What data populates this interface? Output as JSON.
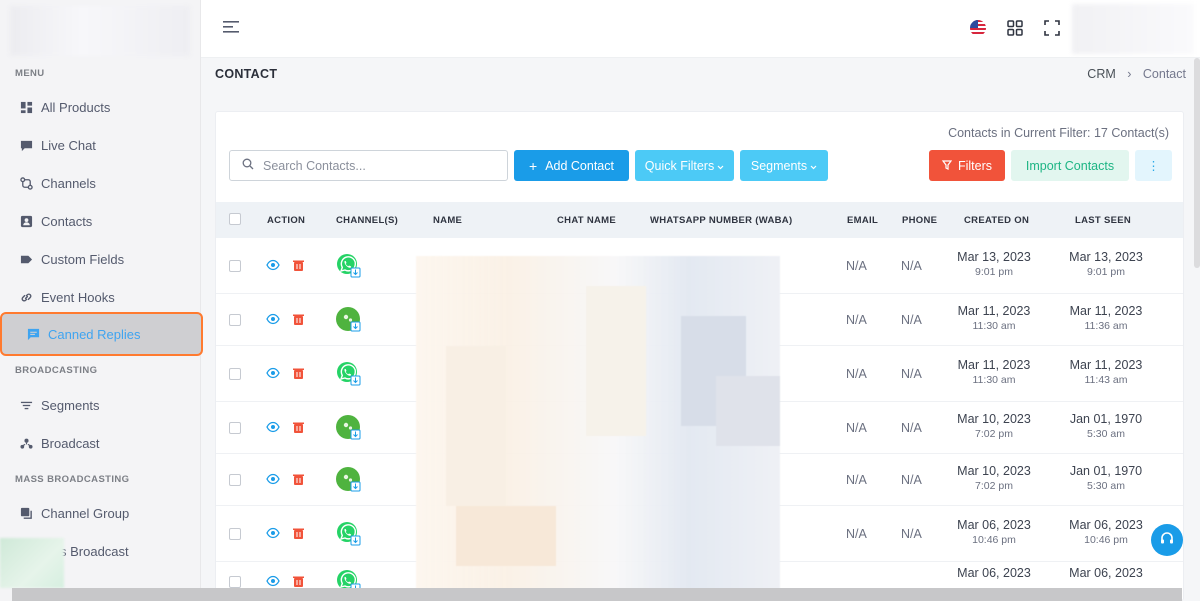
{
  "sidebar": {
    "sections": {
      "menu": "MENU",
      "broadcasting": "BROADCASTING",
      "mass_broadcasting": "MASS BROADCASTING"
    },
    "items": [
      {
        "label": "All Products",
        "icon": "grid-icon"
      },
      {
        "label": "Live Chat",
        "icon": "chat-icon"
      },
      {
        "label": "Channels",
        "icon": "channels-icon"
      },
      {
        "label": "Contacts",
        "icon": "contacts-icon"
      },
      {
        "label": "Custom Fields",
        "icon": "tag-icon"
      },
      {
        "label": "Event Hooks",
        "icon": "link-icon"
      },
      {
        "label": "Canned Replies",
        "icon": "message-icon",
        "active": true
      },
      {
        "label": "Segments",
        "icon": "filter-lines-icon"
      },
      {
        "label": "Broadcast",
        "icon": "broadcast-icon"
      },
      {
        "label": "Channel Group",
        "icon": "layers-icon"
      },
      {
        "label": "s Broadcast",
        "icon": "broadcast-icon"
      }
    ]
  },
  "header": {
    "page_title": "CONTACT",
    "breadcrumb": {
      "parent": "CRM",
      "current": "Contact"
    },
    "separator": "›"
  },
  "toolbar": {
    "filter_count": "Contacts in Current Filter: 17 Contact(s)",
    "search_placeholder": "Search Contacts...",
    "add_contact": "Add Contact",
    "quick_filters": "Quick Filters",
    "segments": "Segments",
    "filters": "Filters",
    "import_contacts": "Import Contacts",
    "more": "⋮"
  },
  "table": {
    "headers": {
      "action": "ACTION",
      "channels": "CHANNEL(S)",
      "name": "NAME",
      "chat_name": "CHAT NAME",
      "whatsapp": "WHATSAPP NUMBER (WABA)",
      "email": "EMAIL",
      "phone": "PHONE",
      "created_on": "CREATED ON",
      "last_seen": "LAST SEEN"
    },
    "rows": [
      {
        "channel": "whatsapp",
        "email": "N/A",
        "phone": "N/A",
        "created_date": "Mar 13, 2023",
        "created_time": "9:01 pm",
        "seen_date": "Mar 13, 2023",
        "seen_time": "9:01 pm"
      },
      {
        "channel": "avatar",
        "email": "N/A",
        "phone": "N/A",
        "created_date": "Mar 11, 2023",
        "created_time": "11:30 am",
        "seen_date": "Mar 11, 2023",
        "seen_time": "11:36 am"
      },
      {
        "channel": "whatsapp",
        "email": "N/A",
        "phone": "N/A",
        "created_date": "Mar 11, 2023",
        "created_time": "11:30 am",
        "seen_date": "Mar 11, 2023",
        "seen_time": "11:43 am"
      },
      {
        "channel": "avatar",
        "email": "N/A",
        "phone": "N/A",
        "created_date": "Mar 10, 2023",
        "created_time": "7:02 pm",
        "seen_date": "Jan 01, 1970",
        "seen_time": "5:30 am"
      },
      {
        "channel": "avatar",
        "email": "N/A",
        "phone": "N/A",
        "created_date": "Mar 10, 2023",
        "created_time": "7:02 pm",
        "seen_date": "Jan 01, 1970",
        "seen_time": "5:30 am"
      },
      {
        "channel": "whatsapp",
        "email": "N/A",
        "phone": "N/A",
        "created_date": "Mar 06, 2023",
        "created_time": "10:46 pm",
        "seen_date": "Mar 06, 2023",
        "seen_time": "10:46 pm"
      },
      {
        "channel": "whatsapp",
        "email": "",
        "phone": "",
        "created_date": "Mar 06, 2023",
        "created_time": "",
        "seen_date": "Mar 06, 2023",
        "seen_time": ""
      }
    ]
  },
  "colors": {
    "primary": "#1a9ce8",
    "info": "#4ccaf6",
    "danger": "#f1533a",
    "success_soft": "#e2f6ef",
    "active_border": "#ff7a2f",
    "whatsapp": "#25d366"
  }
}
